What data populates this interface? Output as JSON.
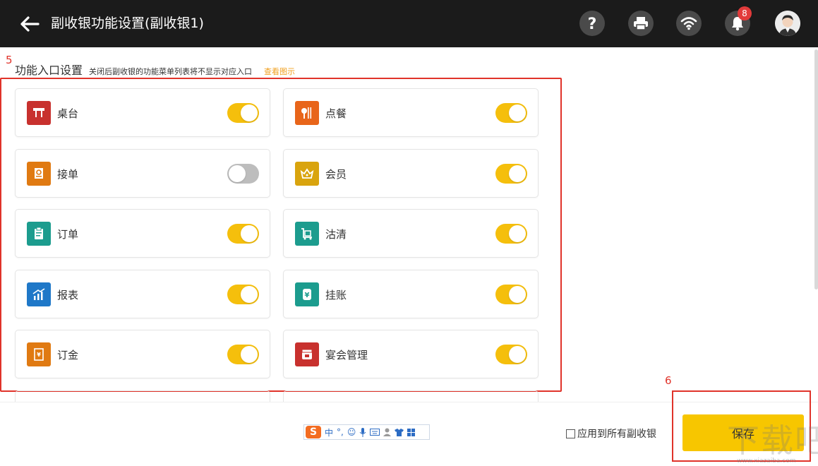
{
  "header": {
    "title": "副收银功能设置(副收银1)",
    "notification_count": "8",
    "icons": [
      "back-arrow-icon",
      "help-icon",
      "printer-icon",
      "wifi-icon",
      "bell-icon",
      "avatar-icon"
    ]
  },
  "annotations": {
    "section_number": "5",
    "save_number": "6"
  },
  "section": {
    "title": "功能入口设置",
    "description": "关闭后副收银的功能菜单列表将不显示对应入口",
    "link": "查看图示"
  },
  "functions": [
    {
      "label": "桌台",
      "enabled": true,
      "icon": "table-icon",
      "color": "#c8312e"
    },
    {
      "label": "点餐",
      "enabled": true,
      "icon": "utensils-icon",
      "color": "#e8651a"
    },
    {
      "label": "接单",
      "enabled": false,
      "icon": "receipt-icon",
      "color": "#e07a12"
    },
    {
      "label": "会员",
      "enabled": true,
      "icon": "crown-icon",
      "color": "#d9a40e"
    },
    {
      "label": "订单",
      "enabled": true,
      "icon": "clipboard-icon",
      "color": "#1c9c8e"
    },
    {
      "label": "沽清",
      "enabled": true,
      "icon": "cart-icon",
      "color": "#1c9c8e"
    },
    {
      "label": "报表",
      "enabled": true,
      "icon": "chart-icon",
      "color": "#1f78c8"
    },
    {
      "label": "挂账",
      "enabled": true,
      "icon": "yen-icon",
      "color": "#1c9c8e"
    },
    {
      "label": "订金",
      "enabled": true,
      "icon": "deposit-icon",
      "color": "#e07a12"
    },
    {
      "label": "宴会管理",
      "enabled": true,
      "icon": "banquet-icon",
      "color": "#c8312e"
    }
  ],
  "footer": {
    "apply_all_label": "应用到所有副收银",
    "save_label": "保存",
    "ime_logo": "S",
    "ime_lang": "中",
    "ime_punct": "°,"
  },
  "watermark": {
    "text": "下载吧",
    "url": "www.xiazaiba.com"
  },
  "colors": {
    "accent": "#f5bf0c",
    "header_bg": "#1b1b1b",
    "annotation_red": "#e0332a"
  }
}
